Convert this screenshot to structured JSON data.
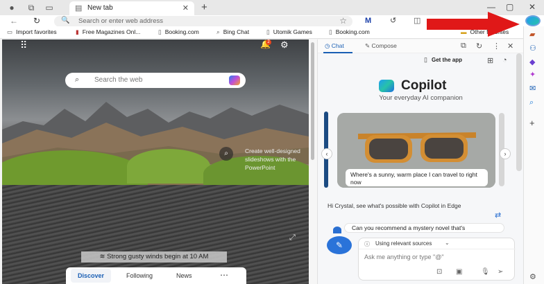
{
  "browser": {
    "tab_title": "New tab",
    "new_tab_symbol": "+",
    "window_controls": {
      "minimize": "—",
      "maximize": "▢",
      "close": "✕"
    },
    "address_placeholder": "Search or enter web address"
  },
  "favorites": [
    {
      "icon": "folder-icon",
      "label": "Import favorites"
    },
    {
      "icon": "magazine-icon",
      "label": "Free Magazines Onl..."
    },
    {
      "icon": "page-icon",
      "label": "Booking.com"
    },
    {
      "icon": "search-icon",
      "label": "Bing Chat"
    },
    {
      "icon": "page-icon",
      "label": "Utomik Games"
    },
    {
      "icon": "page-icon",
      "label": "Booking.com"
    },
    {
      "icon": "folder-icon",
      "label": "Other favorites"
    }
  ],
  "newtab": {
    "search_placeholder": "Search the web",
    "notification_count": "2",
    "caption": "Create well-designed slideshows with the PowerPoint",
    "weather": "Strong gusty winds begin at 10 AM",
    "feed_tabs": [
      "Discover",
      "Following",
      "News"
    ],
    "feed_more": "⋯"
  },
  "copilot": {
    "tabs": [
      "Chat",
      "Compose"
    ],
    "get_app": "Get the app",
    "title": "Copilot",
    "subtitle": "Your everyday AI companion",
    "card_text": "Where's a sunny, warm place I can travel to right now",
    "intro": "Hi Crystal, see what's possible with Copilot in Edge",
    "suggestion": "Can you recommend a mystery novel that's",
    "sources": "Using relevant sources",
    "input_placeholder": "Ask me anything or type \"@\""
  },
  "colors": {
    "accent": "#1a5fb4",
    "arrow": "#e01818",
    "copilot_btn": "#2a73d9"
  }
}
